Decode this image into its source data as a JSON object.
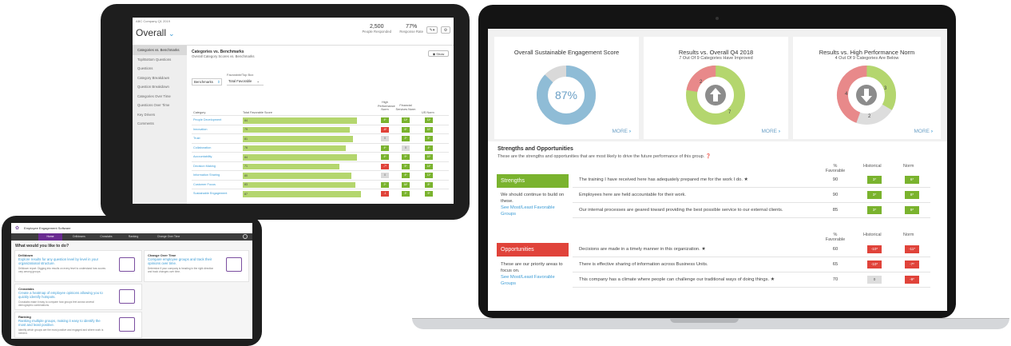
{
  "tablet": {
    "company": "ABC Company Q1 2019",
    "overall": "Overall",
    "stats": [
      {
        "value": "2,500",
        "label": "People Responded"
      },
      {
        "value": "77%",
        "label": "Response Rate"
      }
    ],
    "sidebar": [
      "Categories vs. Benchmarks",
      "Top/Bottom Questions",
      "Questions",
      "Category Breakdown",
      "Question Breakdown",
      "Categories Over Time",
      "Questions Over Time",
      "Key Drivers",
      "Comments"
    ],
    "title": "Categories vs. Benchmarks",
    "subtitle": "Overall Category Scores vs. Benchmarks",
    "show_button": "Show",
    "fav_label": "Favorable/Top Box",
    "benchmark_select": "Benchmarks",
    "fav_select": "Total Favorable",
    "headers": {
      "category": "Category",
      "score": "Total Favorable Score",
      "hp": "High Performance Norm",
      "fs": "Financial Services Norm",
      "us": "US Norm"
    },
    "rows": [
      {
        "cat": "People Development",
        "val": 84,
        "b": [
          "4*",
          "11*",
          "11*"
        ],
        "c": [
          "g",
          "g",
          "g"
        ]
      },
      {
        "cat": "Innovation",
        "val": 79,
        "b": [
          "-6*",
          "6*",
          "10*"
        ],
        "c": [
          "r",
          "g",
          "g"
        ]
      },
      {
        "cat": "Trust",
        "val": 81,
        "b": [
          "0",
          "2*",
          "5*"
        ],
        "c": [
          "y",
          "g",
          "g"
        ]
      },
      {
        "cat": "Collaboration",
        "val": 76,
        "b": [
          "4*",
          "0",
          "4*"
        ],
        "c": [
          "g",
          "y",
          "g"
        ]
      },
      {
        "cat": "Accountability",
        "val": 84,
        "b": [
          "4*",
          "9*",
          "10*"
        ],
        "c": [
          "g",
          "g",
          "g"
        ]
      },
      {
        "cat": "Decision Making",
        "val": 71,
        "b": [
          "-7*",
          "5*",
          "14*"
        ],
        "c": [
          "r",
          "g",
          "g"
        ]
      },
      {
        "cat": "Information Sharing",
        "val": 80,
        "b": [
          "0",
          "4*",
          "11*"
        ],
        "c": [
          "y",
          "g",
          "g"
        ]
      },
      {
        "cat": "Customer Focus",
        "val": 83,
        "b": [
          "2*",
          "16*",
          "8*"
        ],
        "c": [
          "g",
          "g",
          "g"
        ]
      },
      {
        "cat": "Sustainable Engagement",
        "val": 87,
        "b": [
          "-1",
          "3*",
          "9*"
        ],
        "c": [
          "r",
          "g",
          "g"
        ]
      }
    ]
  },
  "phone": {
    "title": "Employee Engagement Software",
    "nav": [
      "Home",
      "Drilldowns",
      "Crosstabs",
      "Ranking",
      "Change Over Time"
    ],
    "question": "What would you like to do?",
    "cards": [
      {
        "title": "Drilldown",
        "link": "Explore results for any question level by level in your organizational structure.",
        "desc": "Drilldown report: Digging into results on every level to understand how scores vary among groups."
      },
      {
        "title": "Change Over Time",
        "link": "Compare employee groups and track their opinions over time.",
        "desc": "Determine if your company is heading in the right direction and track changes over time."
      },
      {
        "title": "Crosstabs",
        "link": "Create a heatmap of employee opinions allowing you to quickly identify hotspots.",
        "desc": "Crosstabs make it easy to compare how groups feel across several demographic combinations."
      },
      {
        "title": "Ranking",
        "link": "Ranking multiple groups, making it easy to identify the most and least positive.",
        "desc": "Identify which groups are the most positive and engaged and where work is needed."
      }
    ]
  },
  "laptop": {
    "cards": [
      {
        "title": "Overall Sustainable Engagement Score",
        "subtitle": "",
        "center": "87%",
        "more": "MORE"
      },
      {
        "title": "Results vs. Overall Q4 2018",
        "subtitle": "7 Out Of 9 Categories Have Improved",
        "more": "MORE",
        "labels": [
          "2",
          "7"
        ]
      },
      {
        "title": "Results vs. High Performance Norm",
        "subtitle": "4 Out Of 9 Categories Are Below",
        "more": "MORE",
        "labels": [
          "4",
          "3",
          "2"
        ]
      }
    ],
    "so_title": "Strengths and Opportunities",
    "so_subtitle": "These are the strengths and opportunities that are most likely to drive the future performance of this group.",
    "col_headers": [
      "% Favorable",
      "Historical",
      "Norm"
    ],
    "strengths": {
      "label": "Strengths",
      "summary": "We should continue to build on these.",
      "link": "See Most/Least Favorable Groups",
      "rows": [
        {
          "text": "The training I have received here has adequately prepared me for the work I do. ★",
          "fav": "90",
          "hist": "3*",
          "norm": "6*"
        },
        {
          "text": "Employees here are held accountable for their work.",
          "fav": "90",
          "hist": "3*",
          "norm": "8*"
        },
        {
          "text": "Our internal processes are geared toward providing the best possible service to our external clients.",
          "fav": "85",
          "hist": "3*",
          "norm": "9*"
        }
      ]
    },
    "opportunities": {
      "label": "Opportunities",
      "summary": "These are our priority areas to focus on.",
      "link": "See Most/Least Favorable Groups",
      "rows": [
        {
          "text": "Decisions are made in a timely manner in this organization. ★",
          "fav": "60",
          "hist": "-10*",
          "norm": "-11*",
          "hc": "r",
          "nc": "r"
        },
        {
          "text": "There is effective sharing of information across Business Units.",
          "fav": "65",
          "hist": "-10*",
          "norm": "-7*",
          "hc": "r",
          "nc": "r"
        },
        {
          "text": "This company has a climate where people can challenge our traditional ways of doing things. ★",
          "fav": "70",
          "hist": "0",
          "norm": "-9*",
          "hc": "gr",
          "nc": "r"
        }
      ]
    }
  }
}
